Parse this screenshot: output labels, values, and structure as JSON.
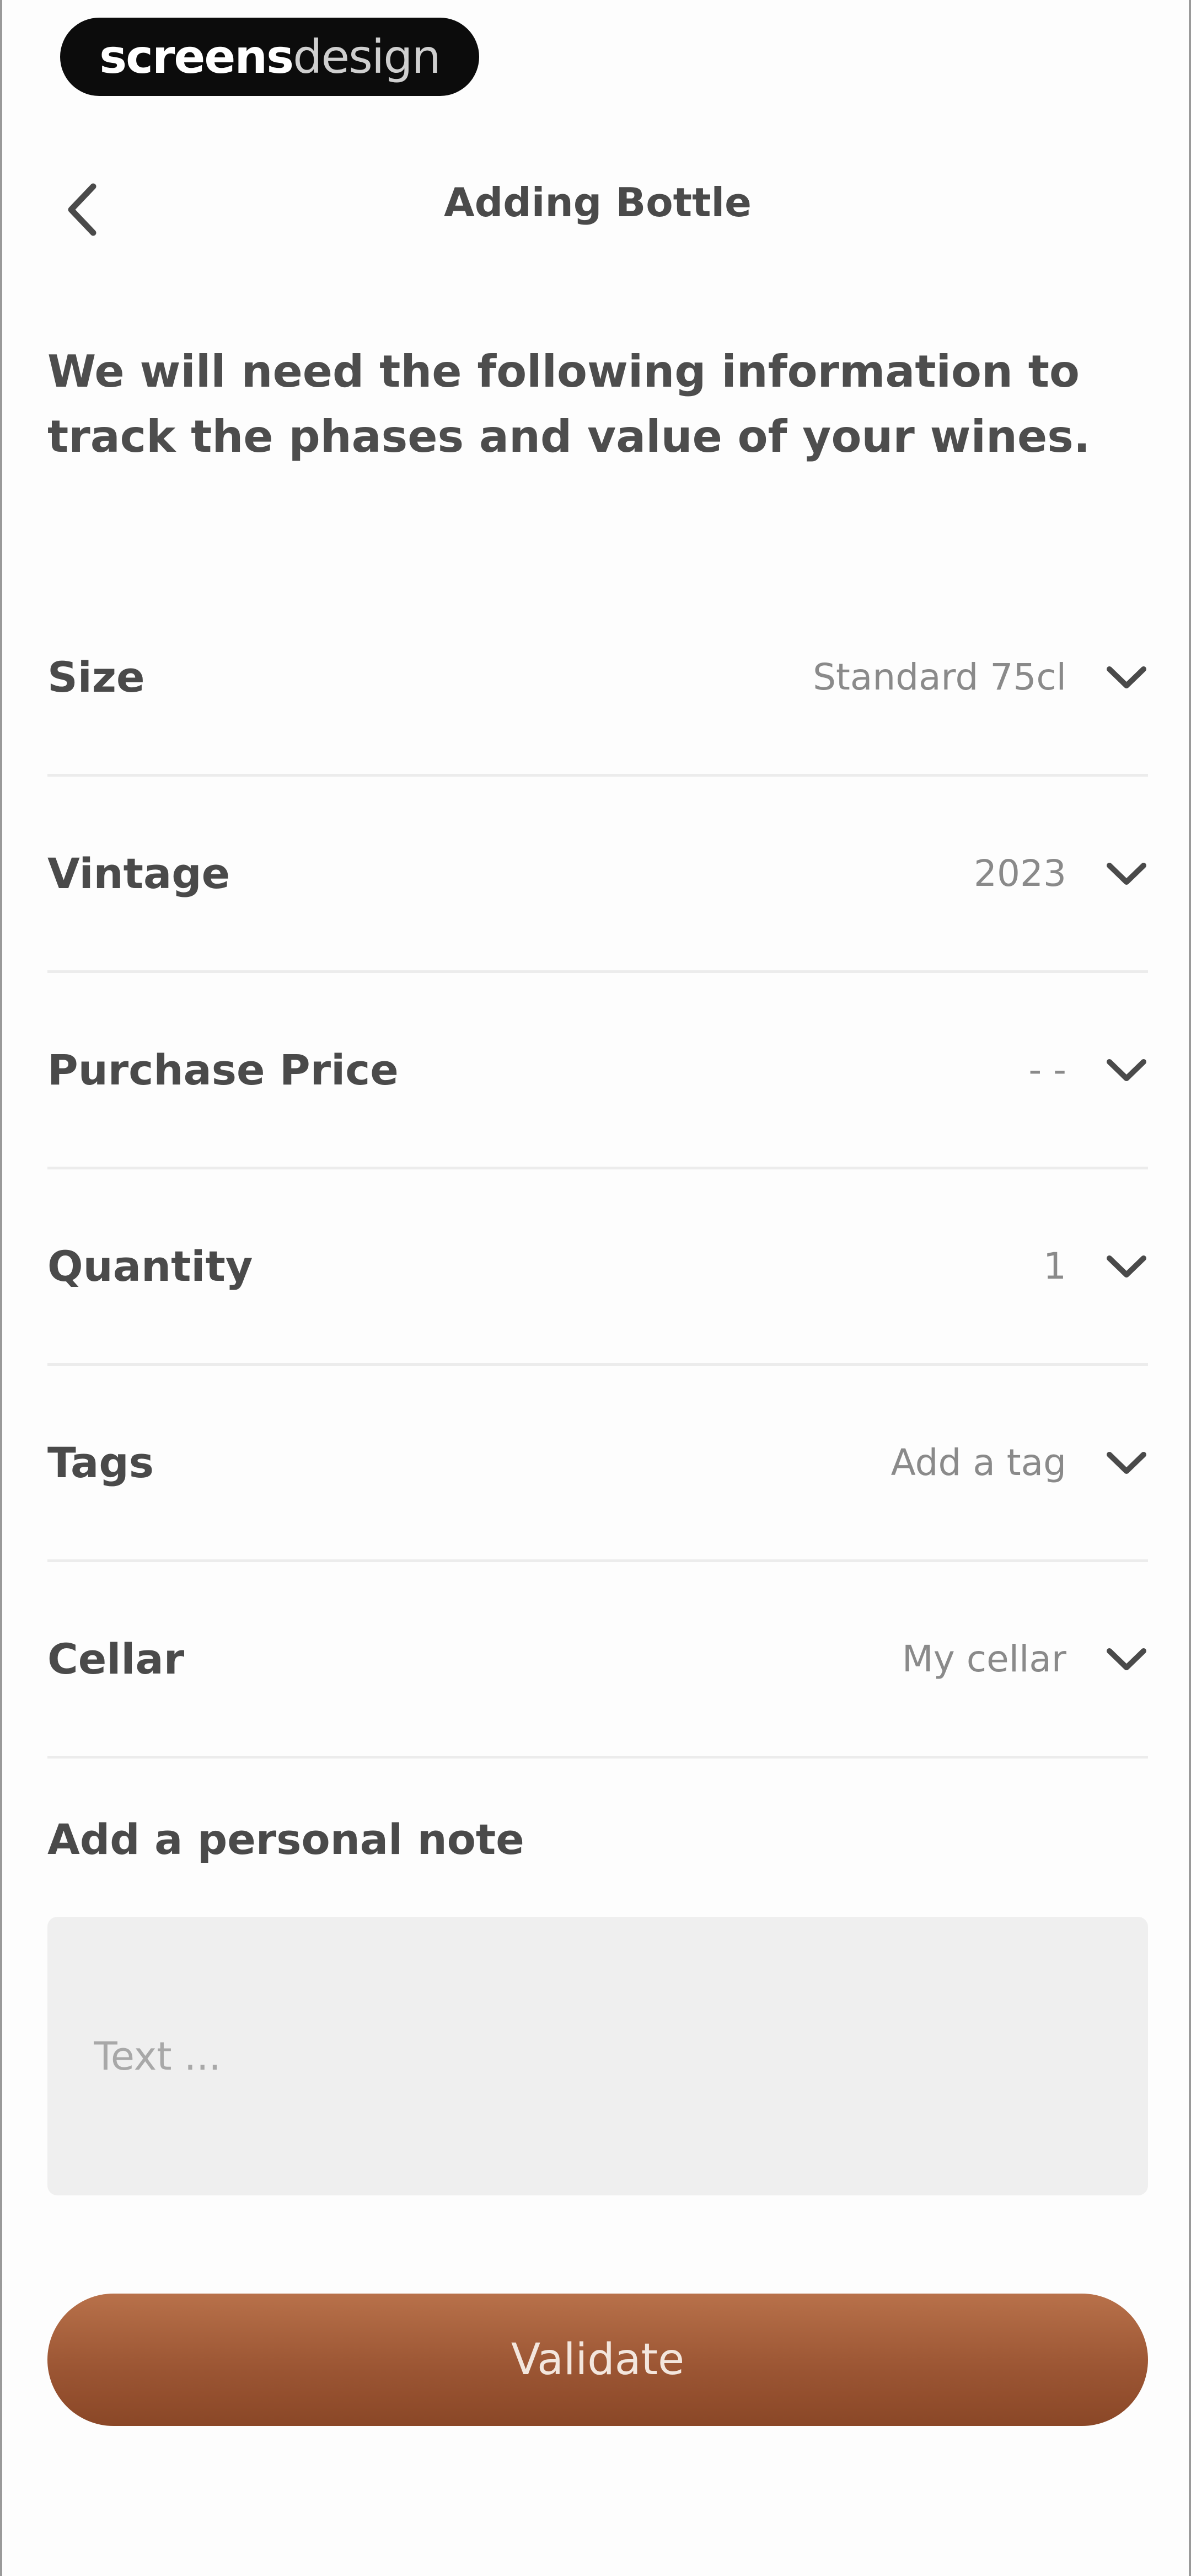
{
  "brand": {
    "part_bold": "screens",
    "part_light": "design"
  },
  "header": {
    "title": "Adding Bottle",
    "back_icon": "chevron-left-icon"
  },
  "intro_text": "We will need the following information to track the phases and value of your wines.",
  "fields": [
    {
      "label": "Size",
      "value": "Standard 75cl",
      "icon": "chevron-down-icon"
    },
    {
      "label": "Vintage",
      "value": "2023",
      "icon": "chevron-down-icon"
    },
    {
      "label": "Purchase Price",
      "value": "- -",
      "icon": "chevron-down-icon"
    },
    {
      "label": "Quantity",
      "value": "1",
      "icon": "chevron-down-icon"
    },
    {
      "label": "Tags",
      "value": "Add a tag",
      "icon": "chevron-down-icon"
    },
    {
      "label": "Cellar",
      "value": "My cellar",
      "icon": "chevron-down-icon"
    }
  ],
  "note": {
    "label": "Add a personal note",
    "placeholder": "Text ...",
    "value": ""
  },
  "validate_button": {
    "label": "Validate"
  },
  "colors": {
    "accent": "#9c5634",
    "input_background": "#efefef",
    "divider": "#ececec"
  }
}
